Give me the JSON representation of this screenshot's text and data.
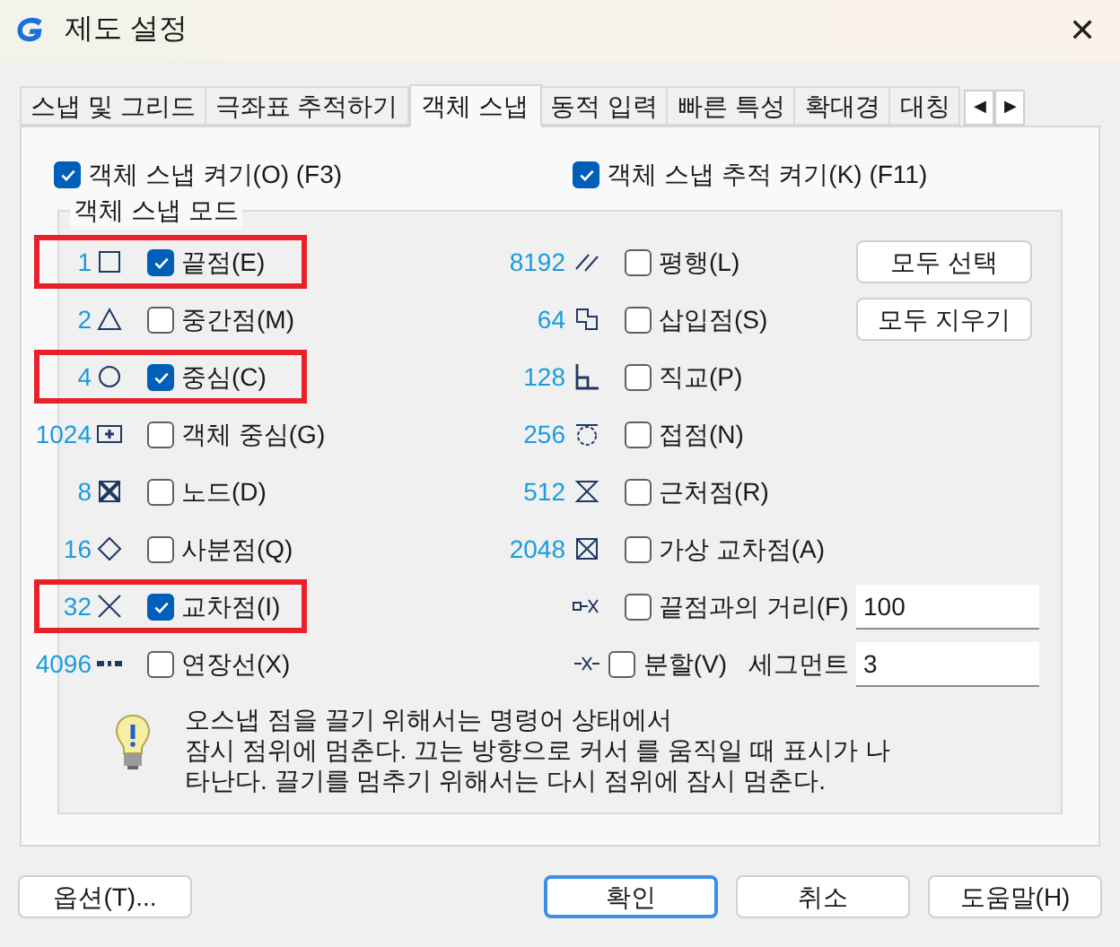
{
  "window": {
    "title": "제도 설정",
    "close": "✕"
  },
  "tabs": [
    {
      "label": "스냅 및 그리드",
      "selected": false
    },
    {
      "label": "극좌표 추적하기",
      "selected": false
    },
    {
      "label": "객체 스냅",
      "selected": true
    },
    {
      "label": "동적 입력",
      "selected": false
    },
    {
      "label": "빠른 특성",
      "selected": false
    },
    {
      "label": "확대경",
      "selected": false
    },
    {
      "label": "대칭",
      "selected": false
    }
  ],
  "tab_scroll": [
    "◀",
    "▶"
  ],
  "toggles": [
    {
      "label": "객체 스냅 켜기(O) (F3)",
      "checked": true
    },
    {
      "label": "객체 스냅 추적 켜기(K) (F11)",
      "checked": true
    }
  ],
  "group": {
    "title": "객체 스냅 모드",
    "left_modes": [
      {
        "code": "1",
        "label": "끝점(E)",
        "checked": true,
        "highlighted": true
      },
      {
        "code": "2",
        "label": "중간점(M)",
        "checked": false,
        "highlighted": false
      },
      {
        "code": "4",
        "label": "중심(C)",
        "checked": true,
        "highlighted": true
      },
      {
        "code": "1024",
        "label": "객체 중심(G)",
        "checked": false,
        "highlighted": false
      },
      {
        "code": "8",
        "label": "노드(D)",
        "checked": false,
        "highlighted": false
      },
      {
        "code": "16",
        "label": "사분점(Q)",
        "checked": false,
        "highlighted": false
      },
      {
        "code": "32",
        "label": "교차점(I)",
        "checked": true,
        "highlighted": true
      },
      {
        "code": "4096",
        "label": "연장선(X)",
        "checked": false,
        "highlighted": false
      }
    ],
    "right_modes": [
      {
        "code": "8192",
        "label": "평행(L)",
        "checked": false
      },
      {
        "code": "64",
        "label": "삽입점(S)",
        "checked": false
      },
      {
        "code": "128",
        "label": "직교(P)",
        "checked": false
      },
      {
        "code": "256",
        "label": "접점(N)",
        "checked": false
      },
      {
        "code": "512",
        "label": "근처점(R)",
        "checked": false
      },
      {
        "code": "2048",
        "label": "가상 교차점(A)",
        "checked": false
      },
      {
        "label": "끝점과의 거리(F)",
        "checked": false,
        "value": "100"
      },
      {
        "label": "분할(V)",
        "checked": false,
        "suffix": "세그먼트",
        "value": "3"
      }
    ],
    "buttons": [
      "모두 선택",
      "모두 지우기"
    ],
    "tip": "오스냅 점을 끌기 위해서는 명령어 상태에서\n잠시 점위에 멈춘다. 끄는 방향으로 커서 를 움직일 때 표시가 나\n타난다. 끌기를 멈추기 위해서는 다시 점위에 잠시 멈춘다."
  },
  "footer_buttons": [
    {
      "label": "옵션(T)...",
      "default": false
    },
    {
      "label": "확인",
      "default": true
    },
    {
      "label": "취소",
      "default": false
    },
    {
      "label": "도움말(H)",
      "default": false
    }
  ]
}
